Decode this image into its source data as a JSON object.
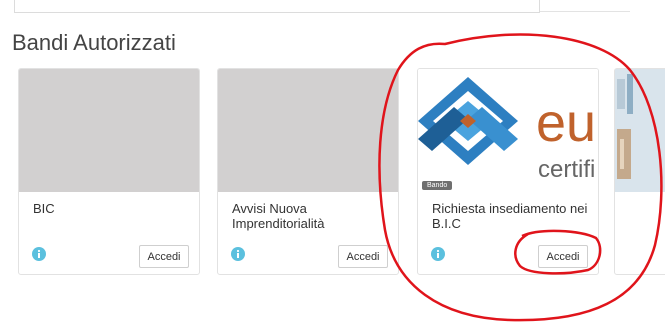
{
  "section": {
    "title": "Bandi Autorizzati"
  },
  "cards": [
    {
      "title": "BIC",
      "button": "Accedi",
      "info_icon": "info-icon"
    },
    {
      "title": "Avvisi Nuova Imprenditorialità",
      "button": "Accedi",
      "info_icon": "info-icon"
    },
    {
      "title": "Richiesta insediamento nei B.I.C",
      "button": "Accedi",
      "info_icon": "info-icon",
      "badge": "Bando",
      "logo_text_top": "eu",
      "logo_text_bottom": "certifi"
    }
  ],
  "colors": {
    "info": "#5bc0de",
    "annotation": "#e0141b",
    "logo_blue": "#2d7fc1",
    "logo_orange": "#c0622c",
    "placeholder": "#d2d0d0"
  }
}
